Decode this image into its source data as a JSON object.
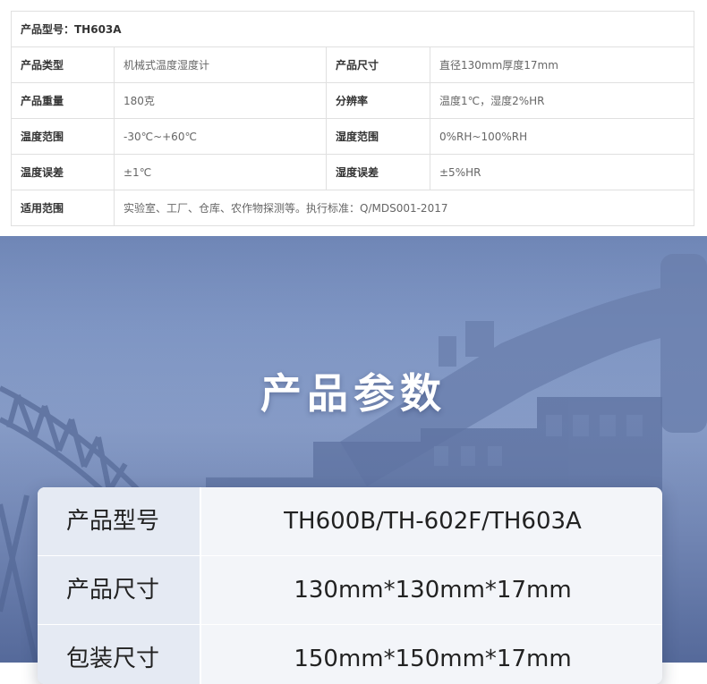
{
  "spec_table": {
    "title": "产品型号：TH603A",
    "rows": [
      {
        "k1": "产品类型",
        "v1": "机械式温度湿度计",
        "k2": "产品尺寸",
        "v2": "直径130mm厚度17mm"
      },
      {
        "k1": "产品重量",
        "v1": "180克",
        "k2": "分辨率",
        "v2": "温度1℃，湿度2%HR"
      },
      {
        "k1": "温度范围",
        "v1": "-30℃~+60℃",
        "k2": "湿度范围",
        "v2": "0%RH~100%RH"
      },
      {
        "k1": "温度误差",
        "v1": "±1℃",
        "k2": "湿度误差",
        "v2": "±5%HR"
      }
    ],
    "last_row": {
      "k": "适用范围",
      "v": "实验室、工厂、仓库、农作物探测等。执行标准：Q/MDS001-2017"
    }
  },
  "banner": {
    "title": "产品参数"
  },
  "param_card": {
    "rows": [
      {
        "key": "产品型号",
        "value": "TH600B/TH-602F/TH603A"
      },
      {
        "key": "产品尺寸",
        "value": "130mm*130mm*17mm"
      },
      {
        "key": "包装尺寸",
        "value": "150mm*150mm*17mm"
      }
    ]
  },
  "colors": {
    "banner_top": "#6f86b6",
    "banner_mid": "#8da2cc",
    "card_bg": "#f3f5f9",
    "card_key_bg": "#e5eaf3"
  }
}
